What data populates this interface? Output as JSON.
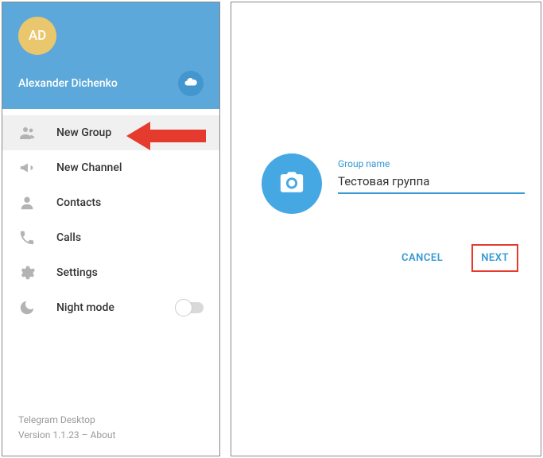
{
  "sidebar": {
    "avatar_initials": "AD",
    "user_name": "Alexander Dichenko",
    "items": [
      {
        "label": "New Group"
      },
      {
        "label": "New Channel"
      },
      {
        "label": "Contacts"
      },
      {
        "label": "Calls"
      },
      {
        "label": "Settings"
      },
      {
        "label": "Night mode"
      }
    ],
    "footer_app": "Telegram Desktop",
    "footer_version_prefix": "Version 1.1.23 – ",
    "footer_about": "About"
  },
  "modal": {
    "input_label": "Group name",
    "group_name_value": "Тестовая группа",
    "cancel": "CANCEL",
    "next": "NEXT"
  }
}
